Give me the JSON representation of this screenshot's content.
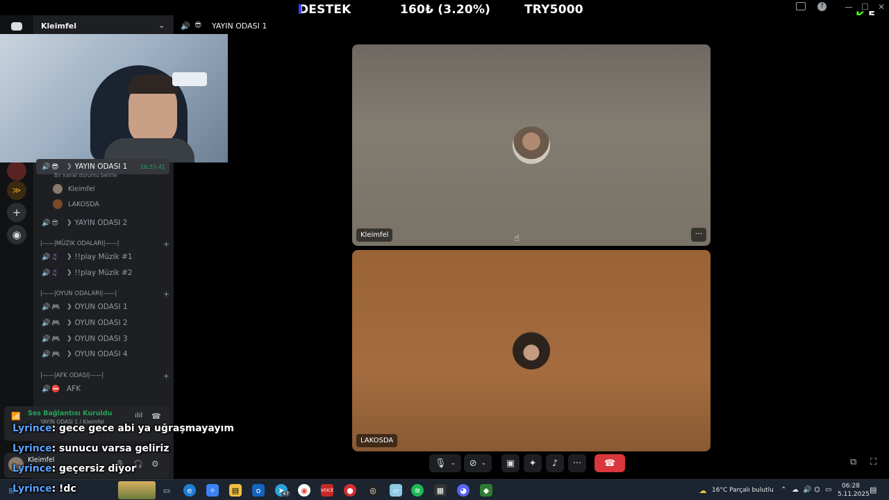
{
  "overlay": {
    "support_label": "DESTEK",
    "donation_amount": "160₺ (3.20%)",
    "goal_label": "TRY5000",
    "viewer_count": "5",
    "kick_logo": "K"
  },
  "sidebar": {
    "server_name": "Kleimfel",
    "channels": [
      {
        "name": "YAYIN ODASI 1",
        "emoji": "😎",
        "active": true,
        "timer": "16:53:41",
        "status": "Bir kanal durumu belirle"
      },
      {
        "name": "YAYIN ODASI 2",
        "emoji": "😎",
        "active": false
      }
    ],
    "members_in_active": [
      {
        "name": "Kleimfel"
      },
      {
        "name": "LAKOSDA"
      }
    ],
    "categories": [
      {
        "label": "|——|MÜZİK ODALARI|——|"
      },
      {
        "label": "|——|OYUN ODALARI|——|"
      },
      {
        "label": "|——|AFK ODASI|——|"
      }
    ],
    "music_channels": [
      "!!play Müzik #1",
      "!!play Müzik #2"
    ],
    "game_channels": [
      "OYUN ODASI 1",
      "OYUN ODASI 2",
      "OYUN ODASI 3",
      "OYUN ODASI 4"
    ],
    "afk_channel": "AFK",
    "voice_status": "Ses Bağlantısı Kuruldu",
    "voice_sub": "YAYIN ODASI 1 / Kleimfel",
    "user_name": "Kleimfel"
  },
  "header": {
    "channel_title": "YAYIN ODASI 1"
  },
  "tiles": [
    {
      "name": "Kleimfel",
      "more": "···"
    },
    {
      "name": "LAKOSDA"
    }
  ],
  "chat": [
    {
      "user": "Lyrince",
      "message": ": gece gece abi ya uğraşmayayım"
    },
    {
      "user": "Lyrince",
      "message": ": sunucu varsa geliriz"
    },
    {
      "user": "Lyrince",
      "message": ": geçersiz diyor"
    },
    {
      "user": "Lyrince",
      "message": ": !dc"
    }
  ],
  "taskbar": {
    "weather": "16°C  Parçalı bulutlu",
    "time": "06:28",
    "date": "5.11.2025",
    "telegram_badge": "47"
  },
  "colors": {
    "discord_bg": "#1e1f22",
    "rail_bg": "#111214",
    "hangup": "#da373c",
    "chat_user": "#5aa3ff",
    "tile1_bg": "#7a7368",
    "tile2_bg": "#a46c3f",
    "kick_green": "#53fc18"
  }
}
